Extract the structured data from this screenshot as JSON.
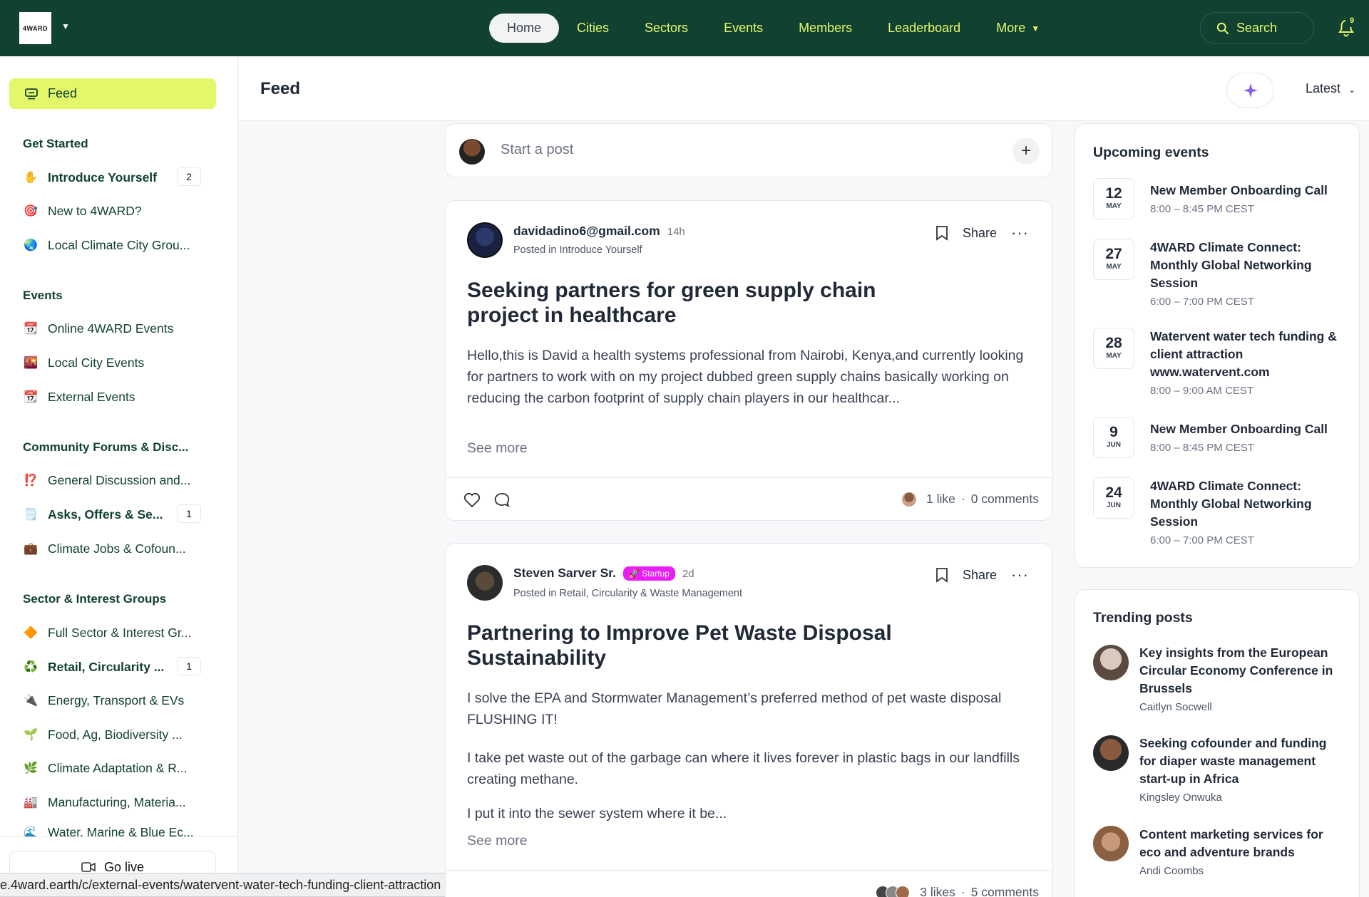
{
  "topbar": {
    "logo_text": "4WARD",
    "nav": [
      {
        "label": "Home"
      },
      {
        "label": "Cities"
      },
      {
        "label": "Sectors"
      },
      {
        "label": "Events"
      },
      {
        "label": "Members"
      },
      {
        "label": "Leaderboard"
      },
      {
        "label": "More"
      }
    ],
    "search_label": "Search",
    "notification_count": "9"
  },
  "sidebar": {
    "feed_label": "Feed",
    "sections": [
      {
        "title": "Get Started",
        "items": [
          {
            "icon": "✋",
            "label": "Introduce Yourself",
            "count": "2"
          },
          {
            "icon": "🎯",
            "label": "New to 4WARD?"
          },
          {
            "icon": "🌏",
            "label": "Local Climate City Grou..."
          }
        ]
      },
      {
        "title": "Events",
        "items": [
          {
            "icon": "📆",
            "label": "Online 4WARD Events"
          },
          {
            "icon": "🌇",
            "label": "Local City Events"
          },
          {
            "icon": "📆",
            "label": "External Events"
          }
        ]
      },
      {
        "title": "Community Forums & Disc...",
        "items": [
          {
            "icon": "⁉️",
            "label": "General Discussion and..."
          },
          {
            "icon": "🗒️",
            "label": "Asks, Offers & Se...",
            "count": "1"
          },
          {
            "icon": "💼",
            "label": "Climate Jobs & Cofoun..."
          }
        ]
      },
      {
        "title": "Sector & Interest Groups",
        "items": [
          {
            "icon": "🔶",
            "label": "Full Sector & Interest Gr..."
          },
          {
            "icon": "♻️",
            "label": "Retail, Circularity ...",
            "count": "1"
          },
          {
            "icon": "🔌",
            "label": "Energy, Transport & EVs"
          },
          {
            "icon": "🌱",
            "label": "Food, Ag, Biodiversity ..."
          },
          {
            "icon": "🌿",
            "label": "Climate Adaptation & R..."
          },
          {
            "icon": "🏭",
            "label": "Manufacturing, Materia..."
          },
          {
            "icon": "🌊",
            "label": "Water, Marine & Blue Ec..."
          }
        ]
      }
    ],
    "go_live_label": "Go live"
  },
  "status_url": "e.4ward.earth/c/external-events/watervent-water-tech-funding-client-attraction",
  "feed": {
    "title": "Feed",
    "sort_label": "Latest",
    "start_post_placeholder": "Start a post",
    "posts": [
      {
        "author": "davidadino6@gmail.com",
        "time": "14h",
        "posted_in": "Posted in Introduce Yourself",
        "title": "Seeking partners for green supply chain project in healthcare",
        "body": "Hello,this is David a health systems professional from Nairobi, Kenya,and currently looking for partners to work with on my project dubbed green supply chains basically working on reducing the carbon footprint of supply chain players in our healthcar...",
        "see_more": "See more",
        "share": "Share",
        "likes": "1 like",
        "comments": "0 comments"
      },
      {
        "author": "Steven Sarver Sr.",
        "badge": "🚀 Startup",
        "time": "2d",
        "posted_in": "Posted in Retail, Circularity & Waste Management",
        "title": "Partnering to Improve Pet Waste Disposal Sustainability",
        "body1": "I solve the EPA and Stormwater Management’s preferred method of pet waste disposal FLUSHING IT!",
        "body2": "I take pet waste out of the garbage can where it lives forever in plastic bags in our landfills creating methane.",
        "body3": "I put it into the sewer system where it be...",
        "see_more": "See more",
        "share": "Share",
        "likes": "3 likes",
        "comments": "5 comments"
      }
    ]
  },
  "upcoming_events": {
    "title": "Upcoming events",
    "items": [
      {
        "day": "12",
        "month": "MAY",
        "title": "New Member Onboarding Call",
        "time": "8:00 – 8:45 PM CEST"
      },
      {
        "day": "27",
        "month": "MAY",
        "title": "4WARD Climate Connect: Monthly Global Networking Session",
        "time": "6:00 – 7:00 PM CEST"
      },
      {
        "day": "28",
        "month": "MAY",
        "title": "Watervent water tech funding & client attraction www.watervent.com",
        "time": "8:00 – 9:00 AM CEST"
      },
      {
        "day": "9",
        "month": "JUN",
        "title": "New Member Onboarding Call",
        "time": "8:00 – 8:45 PM CEST"
      },
      {
        "day": "24",
        "month": "JUN",
        "title": "4WARD Climate Connect: Monthly Global Networking Session",
        "time": "6:00 – 7:00 PM CEST"
      }
    ]
  },
  "trending": {
    "title": "Trending posts",
    "items": [
      {
        "title": "Key insights from the European Circular Economy Conference in Brussels",
        "author": "Caitlyn Socwell"
      },
      {
        "title": "Seeking cofounder and funding for diaper waste management start-up in Africa",
        "author": "Kingsley Onwuka"
      },
      {
        "title": "Content marketing services for eco and adventure brands",
        "author": "Andi Coombs"
      }
    ]
  },
  "colors": {
    "brand_dark": "#114130",
    "accent": "#e4f76a",
    "startup_badge": "#e91ef4"
  }
}
